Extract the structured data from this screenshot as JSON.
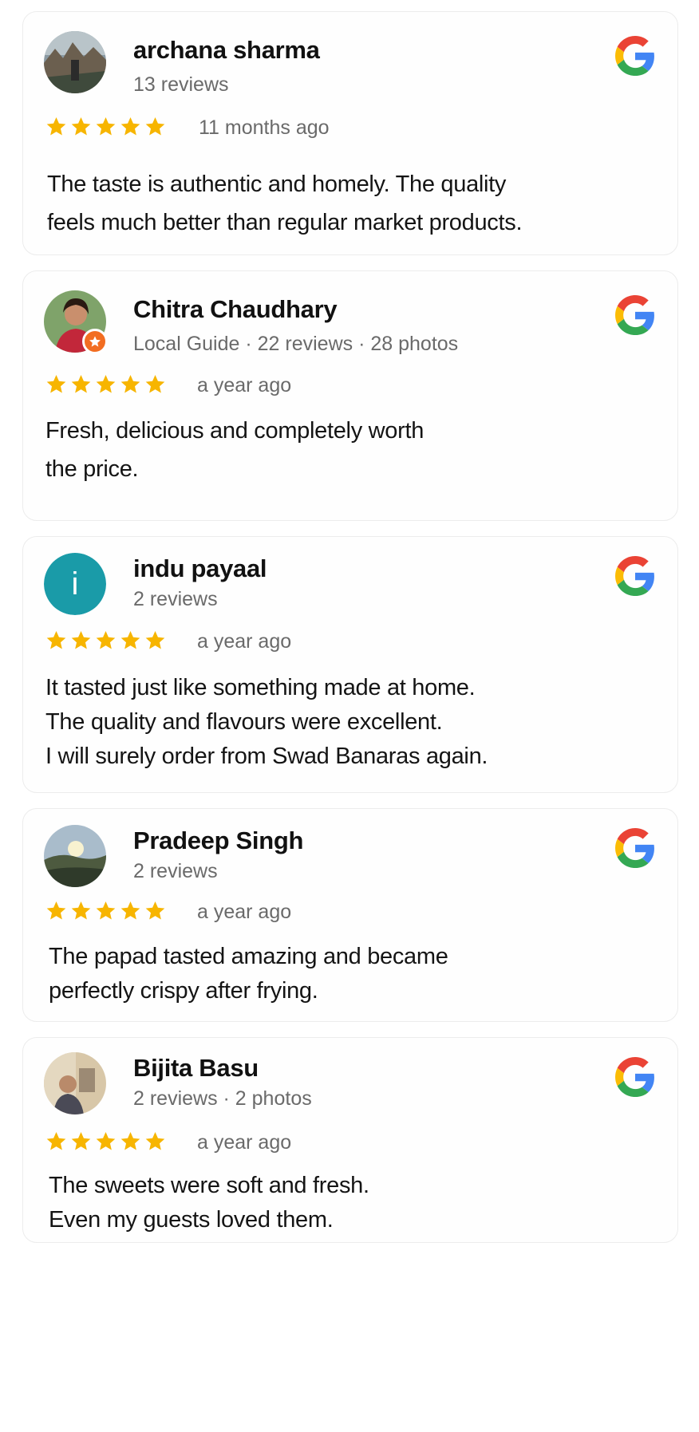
{
  "colors": {
    "star": "#f7b500",
    "avatar_indu": "#1a9ba8",
    "local_guide_badge": "#f26d21",
    "google_blue": "#4285F4",
    "google_red": "#EA4335",
    "google_yellow": "#FBBC05",
    "google_green": "#34A853"
  },
  "reviews": [
    {
      "name": "archana sharma",
      "meta": "13 reviews",
      "rating": 5,
      "time": "11 months ago",
      "text": "The taste is authentic and homely. The quality\nfeels much better than regular market products.",
      "avatar": "photo-avatar",
      "source_icon": "google-logo-icon"
    },
    {
      "name": "Chitra Chaudhary",
      "meta": "Local Guide · 22 reviews · 28 photos",
      "rating": 5,
      "time": "a year ago",
      "text": "Fresh, delicious and completely worth\nthe price.",
      "avatar": "photo-avatar",
      "badge": "local-guide-star-icon",
      "source_icon": "google-logo-icon"
    },
    {
      "name": "indu payaal",
      "meta": "2 reviews",
      "rating": 5,
      "time": "a year ago",
      "text": "It tasted just like something made at home.\nThe quality and flavours were excellent.\nI will surely order from Swad Banaras again.",
      "avatar_letter": "i",
      "source_icon": "google-logo-icon"
    },
    {
      "name": "Pradeep Singh",
      "meta": "2 reviews",
      "rating": 5,
      "time": "a year ago",
      "text": "The papad tasted amazing and became\nperfectly crispy after frying.",
      "avatar": "photo-avatar",
      "source_icon": "google-logo-icon"
    },
    {
      "name": "Bijita Basu",
      "meta": "2 reviews · 2 photos",
      "rating": 5,
      "time": "a year ago",
      "text": "The sweets were soft and fresh.\nEven my guests loved them.",
      "avatar": "photo-avatar",
      "source_icon": "google-logo-icon"
    }
  ]
}
